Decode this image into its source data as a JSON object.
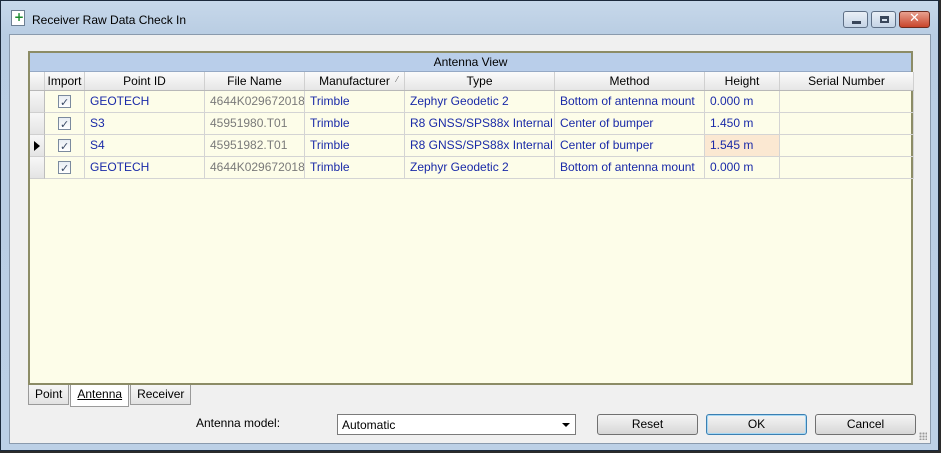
{
  "window": {
    "title": "Receiver Raw Data Check In"
  },
  "grid": {
    "caption": "Antenna View",
    "columns": [
      "Import",
      "Point ID",
      "File Name",
      "Manufacturer",
      "Type",
      "Method",
      "Height",
      "Serial Number"
    ],
    "rows": [
      {
        "import": true,
        "point_id": "GEOTECH",
        "file_name": "4644K029672018",
        "manufacturer": "Trimble",
        "type": "Zephyr Geodetic 2",
        "method": "Bottom of antenna mount",
        "height": "0.000 m",
        "serial": ""
      },
      {
        "import": true,
        "point_id": "S3",
        "file_name": "45951980.T01",
        "manufacturer": "Trimble",
        "type": "R8 GNSS/SPS88x Internal",
        "method": "Center of bumper",
        "height": "1.450 m",
        "serial": ""
      },
      {
        "import": true,
        "point_id": "S4",
        "file_name": "45951982.T01",
        "manufacturer": "Trimble",
        "type": "R8 GNSS/SPS88x Internal",
        "method": "Center of bumper",
        "height": "1.545 m",
        "serial": ""
      },
      {
        "import": true,
        "point_id": "GEOTECH",
        "file_name": "4644K029672018",
        "manufacturer": "Trimble",
        "type": "Zephyr Geodetic 2",
        "method": "Bottom of antenna mount",
        "height": "0.000 m",
        "serial": ""
      }
    ],
    "current_row": 2
  },
  "tabs": [
    {
      "label": "Point",
      "active": false
    },
    {
      "label": "Antenna",
      "active": true
    },
    {
      "label": "Receiver",
      "active": false
    }
  ],
  "controls": {
    "antenna_model_label": "Antenna model:",
    "antenna_model_value": "Automatic",
    "reset_label": "Reset",
    "ok_label": "OK",
    "cancel_label": "Cancel"
  }
}
